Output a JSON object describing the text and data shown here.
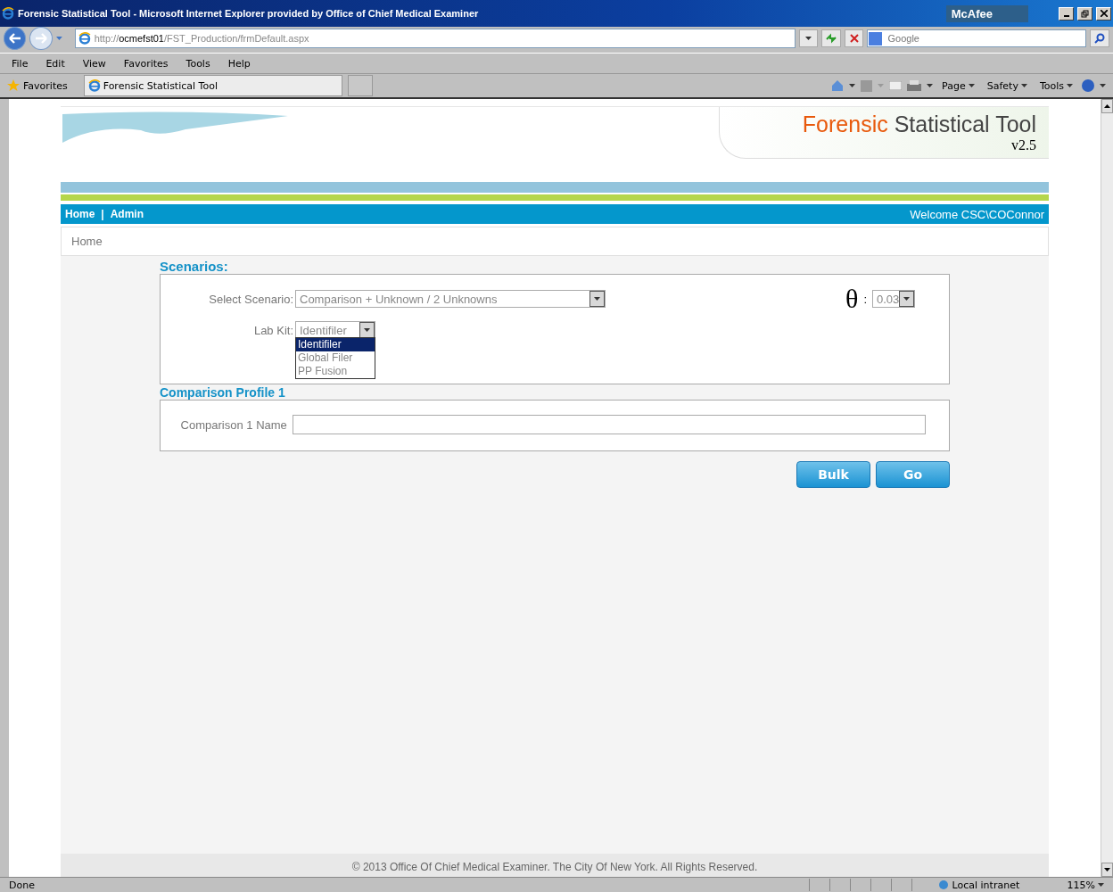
{
  "window": {
    "title": "Forensic Statistical Tool - Microsoft Internet Explorer provided by Office of Chief Medical Examiner",
    "addon": "McAfee"
  },
  "address_bar": {
    "url_prefix": "http://",
    "url_host": "ocmefst01",
    "url_path": "/FST_Production/frmDefault.aspx"
  },
  "search": {
    "placeholder": "Google"
  },
  "menu": [
    "File",
    "Edit",
    "View",
    "Favorites",
    "Tools",
    "Help"
  ],
  "favorites_bar": {
    "label": "Favorites",
    "tab": "Forensic Statistical Tool"
  },
  "command_bar": [
    "Page",
    "Safety",
    "Tools"
  ],
  "site": {
    "title_accent": "Forensic",
    "title_rest": "Statistical Tool",
    "version": "v2.5"
  },
  "nav": {
    "links": [
      "Home",
      "Admin"
    ],
    "separator": "|",
    "welcome": "Welcome CSC\\COConnor"
  },
  "breadcrumb": "Home",
  "scenarios": {
    "heading": "Scenarios:",
    "scenario_label": "Select Scenario:",
    "scenario_value": "Comparison + Unknown / 2 Unknowns",
    "theta": "θ",
    "theta_colon": ":",
    "theta_value": "0.03",
    "labkit_label": "Lab Kit:",
    "labkit_value": "Identifiler",
    "labkit_options": [
      {
        "label": "Identifiler",
        "selected": true
      },
      {
        "label": "Global Filer",
        "selected": false
      },
      {
        "label": "PP Fusion",
        "selected": false
      }
    ]
  },
  "profile": {
    "heading": "Comparison Profile 1",
    "name_label": "Comparison 1 Name"
  },
  "buttons": [
    "Bulk",
    "Go"
  ],
  "footer": "© 2013 Office Of Chief Medical Examiner. The City Of New York. All Rights Reserved.",
  "status_bar": {
    "text": "Done",
    "zone": "Local intranet",
    "zoom": "115%"
  }
}
